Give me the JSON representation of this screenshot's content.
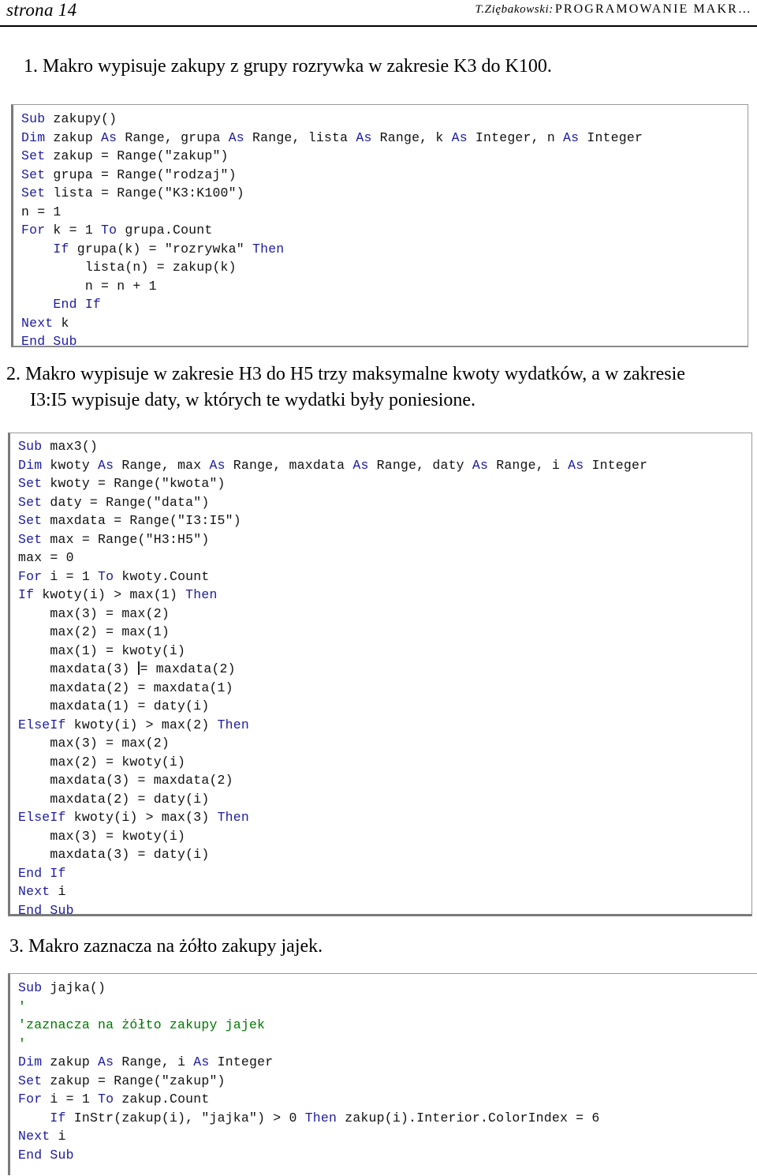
{
  "header": {
    "page_label": "strona 14",
    "author": "T.Ziębakowski:",
    "title": "PROGRAMOWANIE MAKR…"
  },
  "tasks": {
    "task1": "1. Makro wypisuje zakupy z grupy rozrywka w zakresie K3 do K100.",
    "task2_line1": "2. Makro wypisuje w zakresie H3 do H5 trzy  maksymalne kwoty wydatków, a w zakresie",
    "task2_line2": "I3:I5 wypisuje daty, w których te wydatki były poniesione.",
    "task3": "3. Makro zaznacza na żółto zakupy jajek."
  },
  "code_blocks": {
    "block1": {
      "name": "zakupy",
      "lines": [
        [
          {
            "t": "Sub",
            "c": "kw"
          },
          {
            "t": " zakupy()",
            "c": "txt"
          }
        ],
        [
          {
            "t": "Dim",
            "c": "kw"
          },
          {
            "t": " zakup ",
            "c": "txt"
          },
          {
            "t": "As",
            "c": "kw"
          },
          {
            "t": " Range, grupa ",
            "c": "txt"
          },
          {
            "t": "As",
            "c": "kw"
          },
          {
            "t": " Range, lista ",
            "c": "txt"
          },
          {
            "t": "As",
            "c": "kw"
          },
          {
            "t": " Range, k ",
            "c": "txt"
          },
          {
            "t": "As",
            "c": "kw"
          },
          {
            "t": " Integer, n ",
            "c": "txt"
          },
          {
            "t": "As",
            "c": "kw"
          },
          {
            "t": " Integer",
            "c": "txt"
          }
        ],
        [
          {
            "t": "Set",
            "c": "kw"
          },
          {
            "t": " zakup = Range(\"zakup\")",
            "c": "txt"
          }
        ],
        [
          {
            "t": "Set",
            "c": "kw"
          },
          {
            "t": " grupa = Range(\"rodzaj\")",
            "c": "txt"
          }
        ],
        [
          {
            "t": "Set",
            "c": "kw"
          },
          {
            "t": " lista = Range(\"K3:K100\")",
            "c": "txt"
          }
        ],
        [
          {
            "t": "n = 1",
            "c": "txt"
          }
        ],
        [
          {
            "t": "For",
            "c": "kw"
          },
          {
            "t": " k = 1 ",
            "c": "txt"
          },
          {
            "t": "To",
            "c": "kw"
          },
          {
            "t": " grupa.Count",
            "c": "txt"
          }
        ],
        [
          {
            "t": "    ",
            "c": "txt"
          },
          {
            "t": "If",
            "c": "kw"
          },
          {
            "t": " grupa(k) = \"rozrywka\" ",
            "c": "txt"
          },
          {
            "t": "Then",
            "c": "kw"
          }
        ],
        [
          {
            "t": "        lista(n) = zakup(k)",
            "c": "txt"
          }
        ],
        [
          {
            "t": "        n = n + 1",
            "c": "txt"
          }
        ],
        [
          {
            "t": "    ",
            "c": "txt"
          },
          {
            "t": "End If",
            "c": "kw"
          }
        ],
        [
          {
            "t": "Next",
            "c": "kw"
          },
          {
            "t": " k",
            "c": "txt"
          }
        ],
        [
          {
            "t": "End Sub",
            "c": "kw"
          }
        ]
      ]
    },
    "block2": {
      "name": "max3",
      "lines": [
        [
          {
            "t": "Sub",
            "c": "kw"
          },
          {
            "t": " max3()",
            "c": "txt"
          }
        ],
        [
          {
            "t": "Dim",
            "c": "kw"
          },
          {
            "t": " kwoty ",
            "c": "txt"
          },
          {
            "t": "As",
            "c": "kw"
          },
          {
            "t": " Range, max ",
            "c": "txt"
          },
          {
            "t": "As",
            "c": "kw"
          },
          {
            "t": " Range, maxdata ",
            "c": "txt"
          },
          {
            "t": "As",
            "c": "kw"
          },
          {
            "t": " Range, daty ",
            "c": "txt"
          },
          {
            "t": "As",
            "c": "kw"
          },
          {
            "t": " Range, i ",
            "c": "txt"
          },
          {
            "t": "As",
            "c": "kw"
          },
          {
            "t": " Integer",
            "c": "txt"
          }
        ],
        [
          {
            "t": "Set",
            "c": "kw"
          },
          {
            "t": " kwoty = Range(\"kwota\")",
            "c": "txt"
          }
        ],
        [
          {
            "t": "Set",
            "c": "kw"
          },
          {
            "t": " daty = Range(\"data\")",
            "c": "txt"
          }
        ],
        [
          {
            "t": "Set",
            "c": "kw"
          },
          {
            "t": " maxdata = Range(\"I3:I5\")",
            "c": "txt"
          }
        ],
        [
          {
            "t": "Set",
            "c": "kw"
          },
          {
            "t": " max = Range(\"H3:H5\")",
            "c": "txt"
          }
        ],
        [
          {
            "t": "max = 0",
            "c": "txt"
          }
        ],
        [
          {
            "t": "For",
            "c": "kw"
          },
          {
            "t": " i = 1 ",
            "c": "txt"
          },
          {
            "t": "To",
            "c": "kw"
          },
          {
            "t": " kwoty.Count",
            "c": "txt"
          }
        ],
        [
          {
            "t": "If",
            "c": "kw"
          },
          {
            "t": " kwoty(i) > max(1) ",
            "c": "txt"
          },
          {
            "t": "Then",
            "c": "kw"
          }
        ],
        [
          {
            "t": "    max(3) = max(2)",
            "c": "txt"
          }
        ],
        [
          {
            "t": "    max(2) = max(1)",
            "c": "txt"
          }
        ],
        [
          {
            "t": "    max(1) = kwoty(i)",
            "c": "txt"
          }
        ],
        [
          {
            "t": "    maxdata(3) = maxdata(2)",
            "c": "txt",
            "caret_after": "    maxdata(3) "
          }
        ],
        [
          {
            "t": "    maxdata(2) = maxdata(1)",
            "c": "txt"
          }
        ],
        [
          {
            "t": "    maxdata(1) = daty(i)",
            "c": "txt"
          }
        ],
        [
          {
            "t": "ElseIf",
            "c": "kw"
          },
          {
            "t": " kwoty(i) > max(2) ",
            "c": "txt"
          },
          {
            "t": "Then",
            "c": "kw"
          }
        ],
        [
          {
            "t": "    max(3) = max(2)",
            "c": "txt"
          }
        ],
        [
          {
            "t": "    max(2) = kwoty(i)",
            "c": "txt"
          }
        ],
        [
          {
            "t": "    maxdata(3) = maxdata(2)",
            "c": "txt"
          }
        ],
        [
          {
            "t": "    maxdata(2) = daty(i)",
            "c": "txt"
          }
        ],
        [
          {
            "t": "ElseIf",
            "c": "kw"
          },
          {
            "t": " kwoty(i) > max(3) ",
            "c": "txt"
          },
          {
            "t": "Then",
            "c": "kw"
          }
        ],
        [
          {
            "t": "    max(3) = kwoty(i)",
            "c": "txt"
          }
        ],
        [
          {
            "t": "    maxdata(3) = daty(i)",
            "c": "txt"
          }
        ],
        [
          {
            "t": "End If",
            "c": "kw"
          }
        ],
        [
          {
            "t": "Next",
            "c": "kw"
          },
          {
            "t": " i",
            "c": "txt"
          }
        ],
        [
          {
            "t": "End Sub",
            "c": "kw"
          }
        ]
      ]
    },
    "block3": {
      "name": "jajka",
      "lines": [
        [
          {
            "t": "Sub",
            "c": "kw"
          },
          {
            "t": " jajka()",
            "c": "txt"
          }
        ],
        [
          {
            "t": "'",
            "c": "cmt"
          }
        ],
        [
          {
            "t": "'zaznacza na żółto zakupy jajek",
            "c": "cmt"
          }
        ],
        [
          {
            "t": "'",
            "c": "cmt"
          }
        ],
        [
          {
            "t": "Dim",
            "c": "kw"
          },
          {
            "t": " zakup ",
            "c": "txt"
          },
          {
            "t": "As",
            "c": "kw"
          },
          {
            "t": " Range, i ",
            "c": "txt"
          },
          {
            "t": "As",
            "c": "kw"
          },
          {
            "t": " Integer",
            "c": "txt"
          }
        ],
        [
          {
            "t": "Set",
            "c": "kw"
          },
          {
            "t": " zakup = Range(\"zakup\")",
            "c": "txt"
          }
        ],
        [
          {
            "t": "For",
            "c": "kw"
          },
          {
            "t": " i = 1 ",
            "c": "txt"
          },
          {
            "t": "To",
            "c": "kw"
          },
          {
            "t": " zakup.Count",
            "c": "txt"
          }
        ],
        [
          {
            "t": "    ",
            "c": "txt"
          },
          {
            "t": "If",
            "c": "kw"
          },
          {
            "t": " InStr(zakup(i), \"jajka\") > 0 ",
            "c": "txt"
          },
          {
            "t": "Then",
            "c": "kw"
          },
          {
            "t": " zakup(i).Interior.ColorIndex = 6",
            "c": "txt"
          }
        ],
        [
          {
            "t": "Next",
            "c": "kw"
          },
          {
            "t": " i",
            "c": "txt"
          }
        ],
        [
          {
            "t": "End Sub",
            "c": "kw"
          }
        ]
      ]
    }
  },
  "colors": {
    "keyword": "#1c1ca0",
    "comment": "#007700",
    "text": "#111111",
    "rule": "#000000",
    "box_border": "#7a7a7a"
  }
}
